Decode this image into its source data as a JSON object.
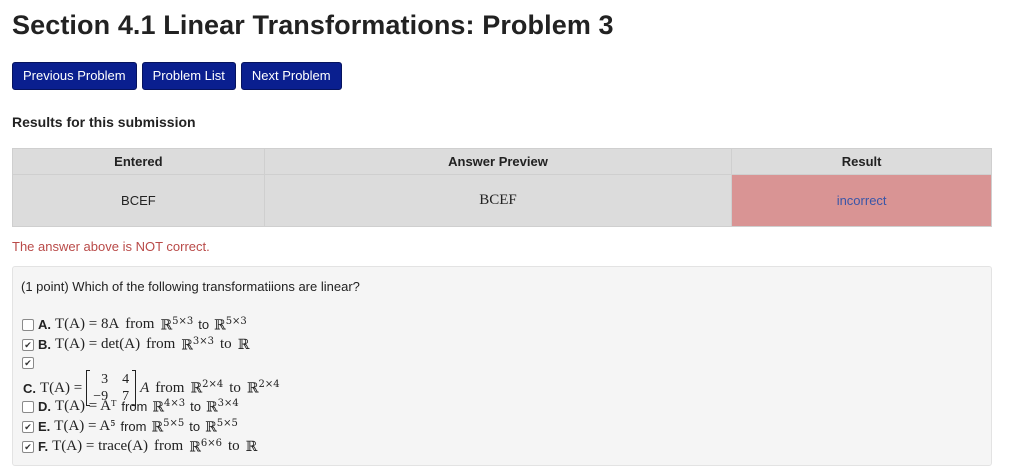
{
  "page": {
    "title": "Section 4.1 Linear Transformations: Problem 3"
  },
  "nav": {
    "previous": "Previous Problem",
    "list": "Problem List",
    "next": "Next Problem"
  },
  "results": {
    "heading": "Results for this submission",
    "columns": [
      "Entered",
      "Answer Preview",
      "Result"
    ],
    "row": {
      "entered": "BCEF",
      "preview": "BCEF",
      "result": "incorrect"
    },
    "status_message": "The answer above is NOT correct.",
    "status_color": "#b94a48",
    "incorrect_bg": "#d99494"
  },
  "problem": {
    "prompt": "(1 point) Which of the following transformatiions are linear?",
    "options": [
      {
        "label": "A.",
        "checked": false,
        "formula": "T(A) = 8A",
        "w1": "from",
        "dom": "ℝ",
        "dom_sup": "5×3",
        "w2": "to",
        "cod": "ℝ",
        "cod_sup": "5×3"
      },
      {
        "label": "B.",
        "checked": true,
        "formula": "T(A) = det(A)",
        "w1": "from",
        "dom": "ℝ",
        "dom_sup": "3×3",
        "w2": "to",
        "cod": "ℝ",
        "cod_sup": ""
      },
      {
        "label": "C.",
        "checked": true,
        "formula_lhs": "T(A) =",
        "matrix": [
          "3",
          "4",
          "−9",
          "7"
        ],
        "formula_rhs": "A",
        "w1": "from",
        "dom": "ℝ",
        "dom_sup": "2×4",
        "w2": "to",
        "cod": "ℝ",
        "cod_sup": "2×4"
      },
      {
        "label": "D.",
        "checked": false,
        "formula": "T(A) = Aᵀ",
        "w1": "from",
        "dom": "ℝ",
        "dom_sup": "4×3",
        "w2": "to",
        "cod": "ℝ",
        "cod_sup": "3×4"
      },
      {
        "label": "E.",
        "checked": true,
        "formula": "T(A) = A⁵",
        "w1": "from",
        "dom": "ℝ",
        "dom_sup": "5×5",
        "w2": "to",
        "cod": "ℝ",
        "cod_sup": "5×5"
      },
      {
        "label": "F.",
        "checked": true,
        "formula": "T(A) = trace(A)",
        "w1": "from",
        "dom": "ℝ",
        "dom_sup": "6×6",
        "w2": "to",
        "cod": "ℝ",
        "cod_sup": ""
      }
    ]
  }
}
